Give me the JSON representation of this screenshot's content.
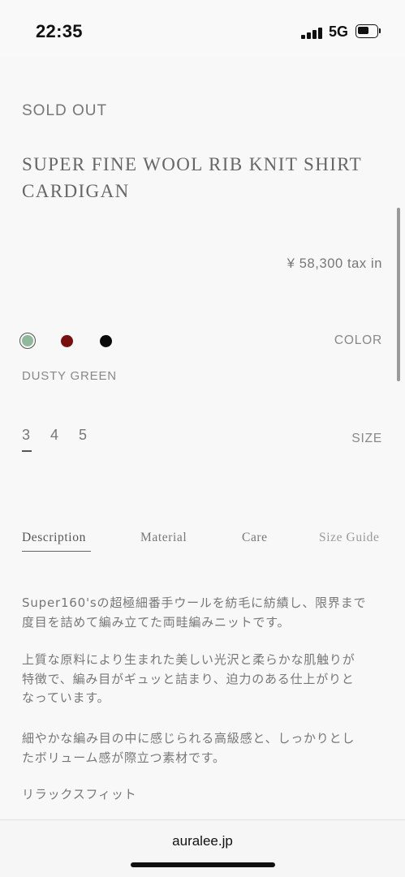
{
  "status_bar": {
    "time": "22:35",
    "network": "5G",
    "battery_level": 0.5
  },
  "product": {
    "status": "SOLD OUT",
    "title_line1": "SUPER FINE WOOL RIB KNIT SHIRT",
    "title_line2": "CARDIGAN",
    "price": "¥ 58,300 tax in",
    "color_label": "COLOR",
    "colors": [
      {
        "name": "DUSTY GREEN",
        "hex": "#8fb99a",
        "selected": true
      },
      {
        "name": "red",
        "hex": "#7a0f0f",
        "selected": false
      },
      {
        "name": "black",
        "hex": "#0a0a0a",
        "selected": false
      }
    ],
    "selected_color": "DUSTY GREEN",
    "size_label": "SIZE",
    "sizes": [
      "3",
      "4",
      "5"
    ],
    "selected_size": "3"
  },
  "tabs": [
    {
      "label": "Description",
      "active": true
    },
    {
      "label": "Material",
      "active": false
    },
    {
      "label": "Care",
      "active": false
    },
    {
      "label": "Size Guide",
      "active": false
    }
  ],
  "description": {
    "p1_line1": "Super160'sの超極細番手ウールを紡毛に紡績し、限界まで",
    "p1_line2": "度目を詰めて編み立てた両畦編みニットです。",
    "p2_line1": "上質な原料により生まれた美しい光沢と柔らかな肌触りが",
    "p2_line2": "特徴で、編み目がギュッと詰まり、迫力のある仕上がりと",
    "p2_line3": "なっています。",
    "p3_line1": "細やかな編み目の中に感じられる高級感と、しっかりとし",
    "p3_line2": "たボリューム感が際立つ素材です。",
    "p4_line1": "リラックスフィット"
  },
  "browser": {
    "url": "auralee.jp"
  }
}
